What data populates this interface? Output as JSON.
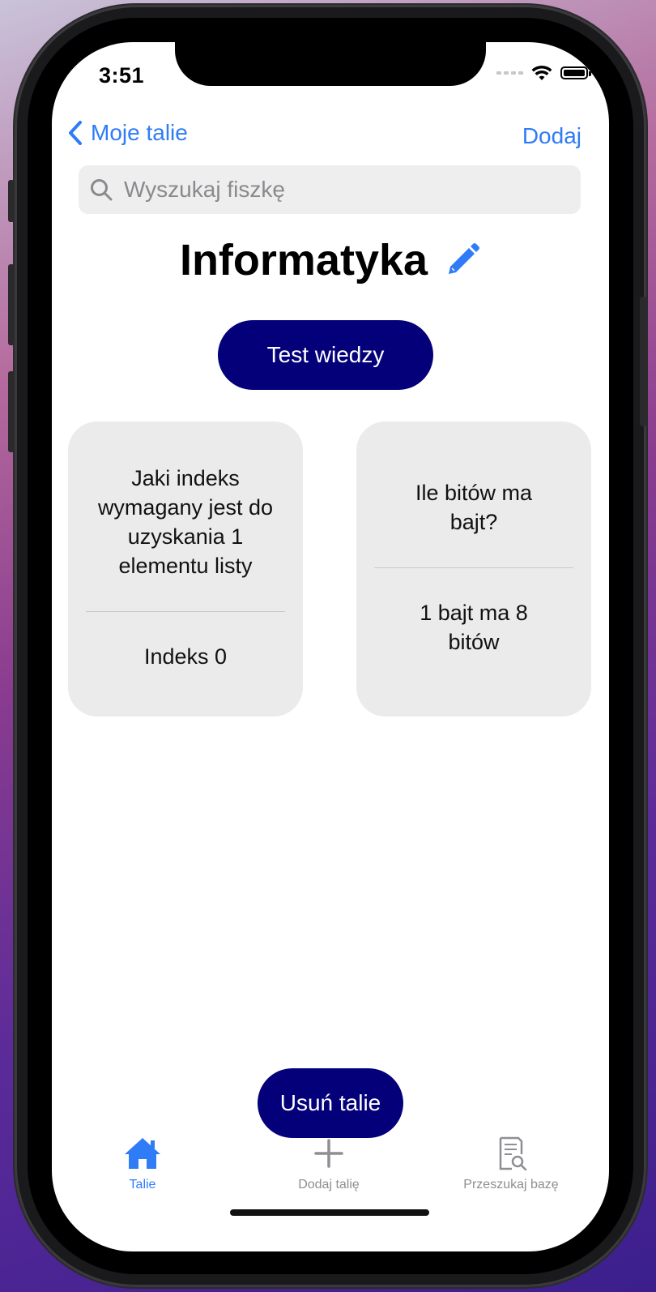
{
  "status": {
    "time": "3:51"
  },
  "nav": {
    "back_label": "Moje talie",
    "add_label": "Dodaj"
  },
  "search": {
    "placeholder": "Wyszukaj fiszkę"
  },
  "deck": {
    "title": "Informatyka"
  },
  "buttons": {
    "test_label": "Test wiedzy",
    "delete_label": "Usuń talie"
  },
  "cards": [
    {
      "question": "Jaki indeks wymagany jest do uzyskania 1 elementu listy",
      "answer": "Indeks 0"
    },
    {
      "question": "Ile bitów ma bajt?",
      "answer": "1 bajt ma 8 bitów"
    }
  ],
  "tabs": [
    {
      "label": "Talie",
      "icon": "house-icon",
      "active": true
    },
    {
      "label": "Dodaj talię",
      "icon": "plus-icon",
      "active": false
    },
    {
      "label": "Przeszukaj bazę",
      "icon": "document-search-icon",
      "active": false
    }
  ],
  "colors": {
    "accent": "#2f7cf6",
    "button": "#04007a",
    "card": "#ebebeb",
    "inactive": "#8e8e93"
  }
}
